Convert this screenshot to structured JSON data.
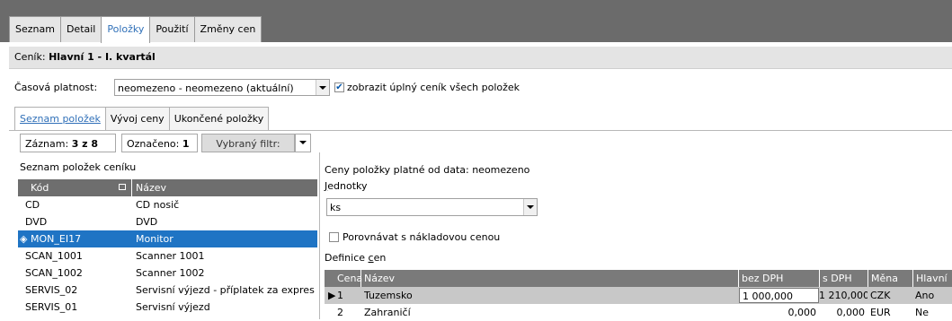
{
  "tabs": [
    {
      "label": "Seznam",
      "active": false
    },
    {
      "label": "Detail",
      "active": false
    },
    {
      "label": "Položky",
      "active": true
    },
    {
      "label": "Použití",
      "active": false
    },
    {
      "label": "Změny cen",
      "active": false
    }
  ],
  "header": {
    "prefix": "Ceník: ",
    "title": "Hlavní 1 - I. kvartál"
  },
  "validity": {
    "label": "Časová platnost:",
    "value": "neomezeno - neomezeno (aktuální)",
    "checkbox_label": "zobrazit úplný ceník všech položek",
    "checked": true
  },
  "subtabs": [
    {
      "label": "Seznam položek",
      "active": true
    },
    {
      "label": "Vývoj ceny",
      "active": false
    },
    {
      "label": "Ukončené položky",
      "active": false
    }
  ],
  "recordbar": {
    "records_label": "Záznam:",
    "records_value": "3 z 8",
    "marked_label": "Označeno:",
    "marked_value": "1",
    "filter_label": "Vybraný filtr:"
  },
  "list": {
    "title": "Seznam položek ceníku",
    "columns": [
      "Kód",
      "Název"
    ],
    "rows": [
      {
        "code": "CD",
        "name": "CD nosič",
        "selected": false
      },
      {
        "code": "DVD",
        "name": "DVD",
        "selected": false
      },
      {
        "code": "MON_EI17",
        "name": "Monitor",
        "selected": true
      },
      {
        "code": "SCAN_1001",
        "name": "Scanner 1001",
        "selected": false
      },
      {
        "code": "SCAN_1002",
        "name": "Scanner 1002",
        "selected": false
      },
      {
        "code": "SERVIS_02",
        "name": "Servisní výjezd - příplatek za expres",
        "selected": false
      },
      {
        "code": "SERVIS_01",
        "name": "Servisní výjezd",
        "selected": false
      }
    ]
  },
  "detail": {
    "prices_from_label": "Ceny položky platné od data:",
    "prices_from_value": "neomezeno",
    "units_label": "Jednotky",
    "units_value": "ks",
    "compare_label": "Porovnávat s nákladovou cenou",
    "compare_checked": false,
    "definition_label": "Definice cen"
  },
  "price_grid": {
    "columns": [
      "Cena",
      "Název",
      "bez DPH",
      "s DPH",
      "Měna",
      "Hlavní"
    ],
    "rows": [
      {
        "cena": "1",
        "nazev": "Tuzemsko",
        "bez": "1 000,000",
        "s": "1 210,000",
        "mena": "CZK",
        "hlavni": "Ano",
        "selected": true
      },
      {
        "cena": "2",
        "nazev": "Zahraničí",
        "bez": "0,000",
        "s": "0,000",
        "mena": "EUR",
        "hlavni": "Ne",
        "selected": false
      }
    ]
  }
}
